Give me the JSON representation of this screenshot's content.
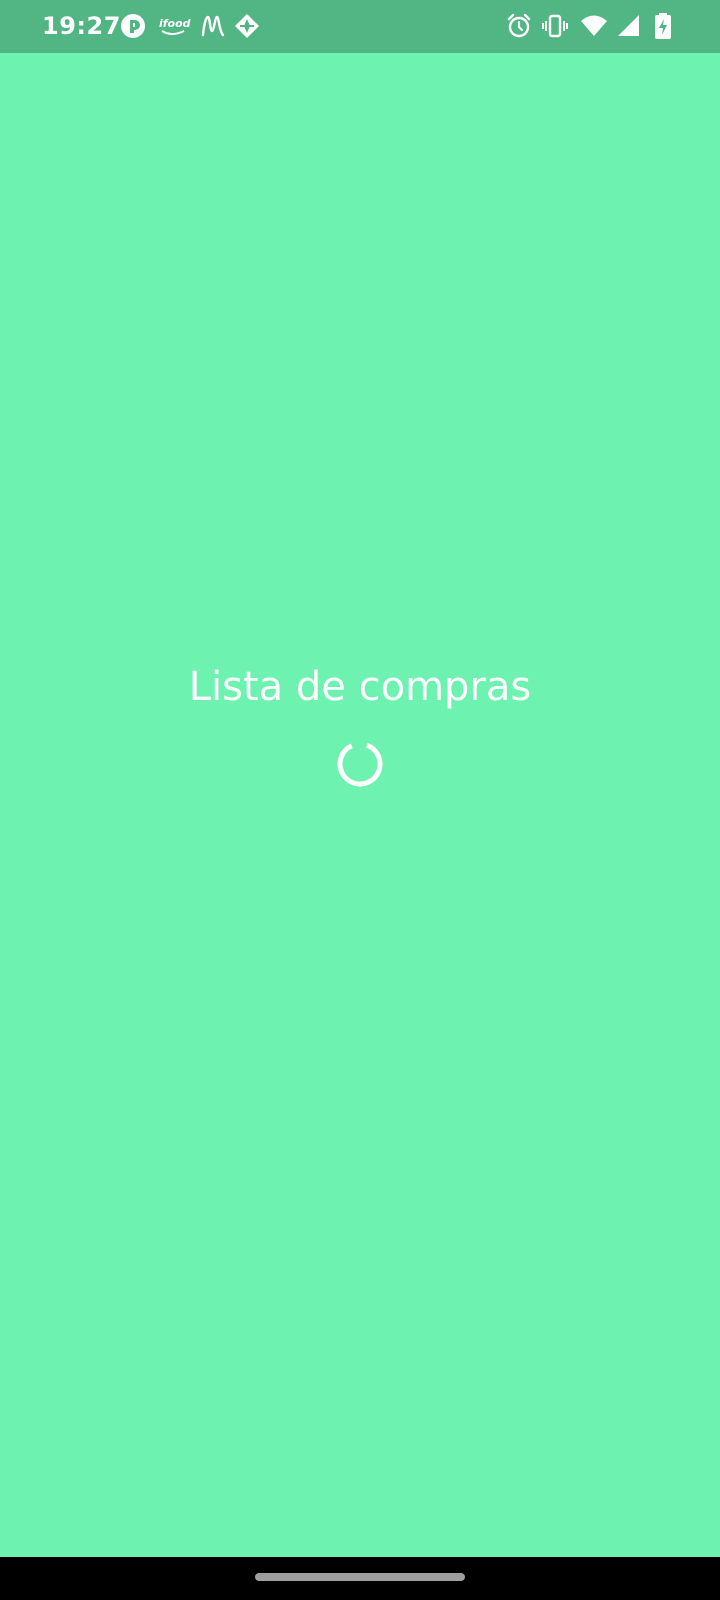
{
  "status_bar": {
    "time": "19:27",
    "notification_icons": [
      "ring-badge-icon",
      "ifood-icon",
      "m-logo-icon",
      "diamond-nav-icon"
    ],
    "ifood_text": "ifood",
    "system_icons": [
      "alarm-icon",
      "vibrate-icon",
      "wifi-icon",
      "signal-icon",
      "battery-charging-icon"
    ]
  },
  "splash": {
    "title": "Lista de compras",
    "background_color": "#6df2b0",
    "loading": true
  },
  "colors": {
    "status_bar": "#52b584",
    "foreground": "#ffffff",
    "nav_bar": "#000000"
  }
}
